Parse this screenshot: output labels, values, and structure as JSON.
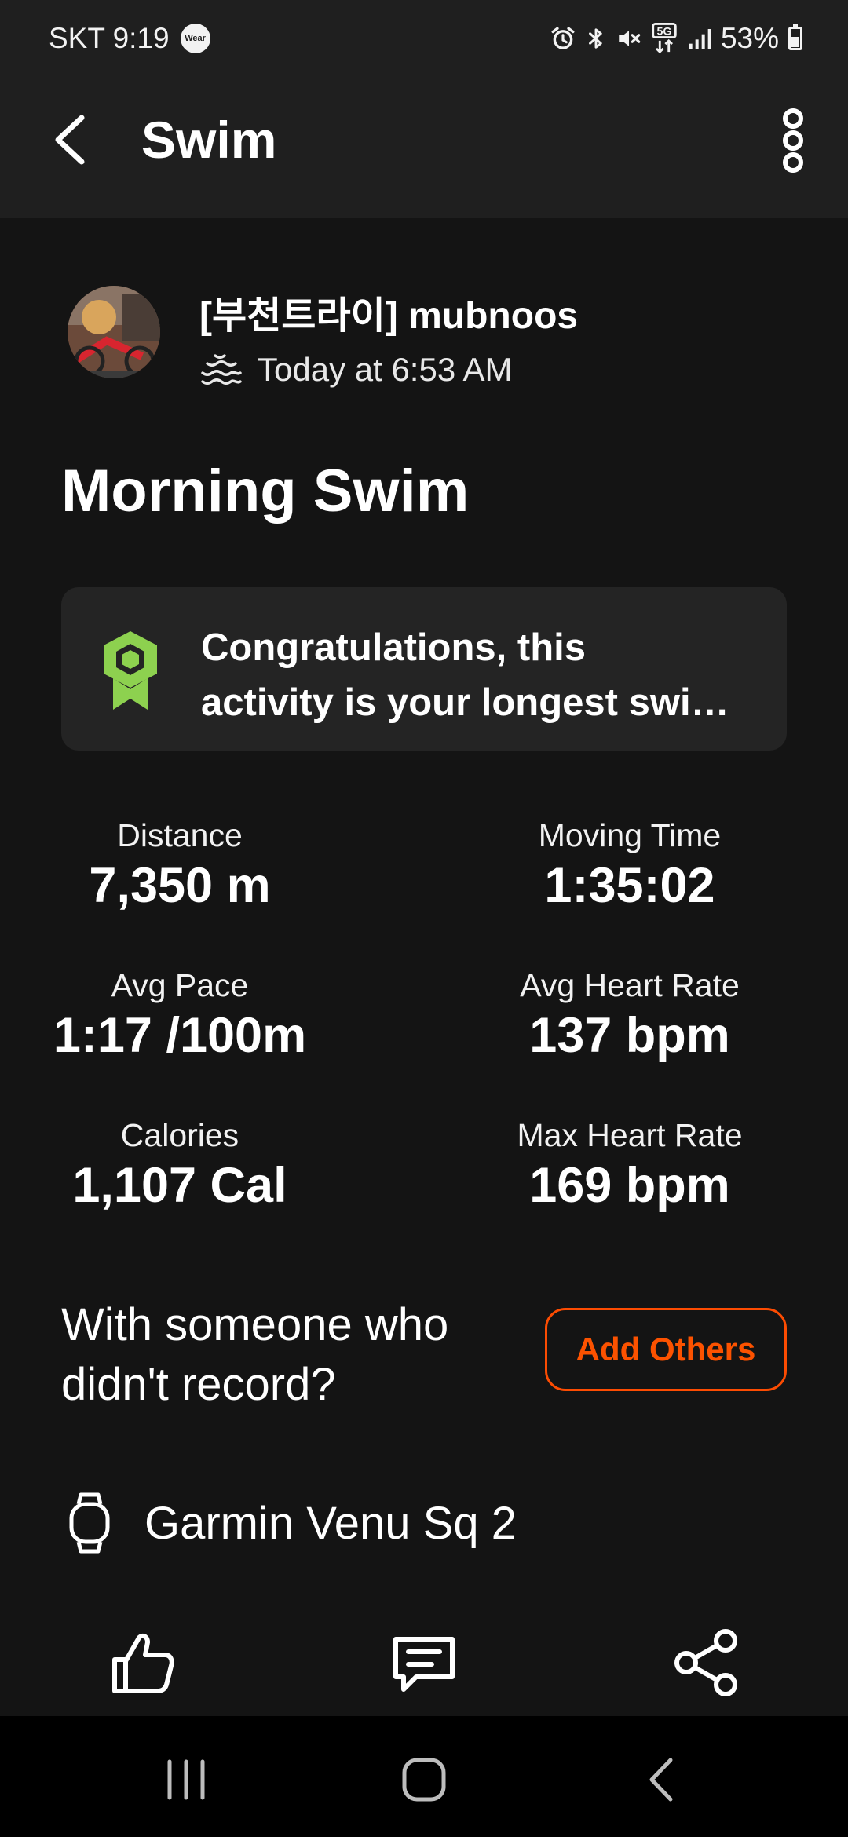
{
  "status_bar": {
    "carrier_time": "SKT 9:19",
    "wear_badge": "Wear",
    "battery": "53%",
    "battery_level": 0.53,
    "icons": [
      "alarm-icon",
      "bluetooth-icon",
      "mute-icon",
      "5g-icon",
      "signal-icon",
      "battery-icon"
    ]
  },
  "app_bar": {
    "title": "Swim",
    "back_icon": "chevron-left-icon",
    "menu_icon": "more-vertical-icon"
  },
  "athlete": {
    "name": "[부천트라이] mubnoos",
    "activity_type_icon": "swim-icon",
    "time": "Today at 6:53 AM"
  },
  "activity": {
    "title": "Morning Swim"
  },
  "achievement": {
    "icon": "medal-icon",
    "line1": "Congratulations, this",
    "line2": "activity is your longest swi…",
    "color": "#8dd14f"
  },
  "stats": [
    {
      "label": "Distance",
      "value": "7,350 m"
    },
    {
      "label": "Moving Time",
      "value": "1:35:02"
    },
    {
      "label": "Avg Pace",
      "value": "1:17 /100m"
    },
    {
      "label": "Avg Heart Rate",
      "value": "137 bpm"
    },
    {
      "label": "Calories",
      "value": "1,107 Cal"
    },
    {
      "label": "Max Heart Rate",
      "value": "169 bpm"
    }
  ],
  "group": {
    "prompt_line1": "With someone who",
    "prompt_line2": "didn't record?",
    "button_label": "Add Others",
    "accent_color": "#fc4c02"
  },
  "device": {
    "icon": "watch-icon",
    "name": "Garmin Venu Sq 2"
  },
  "actions": [
    "like-icon",
    "comment-icon",
    "share-icon"
  ],
  "nav": [
    "recents-icon",
    "home-icon",
    "back-icon"
  ]
}
